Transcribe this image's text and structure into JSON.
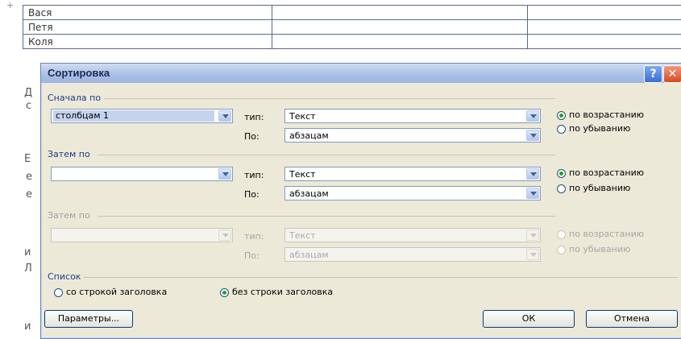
{
  "document": {
    "rows": [
      {
        "name": "Вася"
      },
      {
        "name": "Петя"
      },
      {
        "name": "Коля"
      }
    ],
    "handle_symbol": "+",
    "side_chars": [
      "Д",
      "с",
      "Е",
      "е",
      "е",
      "и",
      "Л",
      "и"
    ]
  },
  "dialog": {
    "title": "Сортировка",
    "help_symbol": "?",
    "close_symbol": "✕",
    "first": {
      "label": "Сначала по",
      "column_value": "столбцам 1",
      "type_label": "тип:",
      "type_value": "Текст",
      "by_label": "По:",
      "by_value": "абзацам",
      "asc_label": "по возрастанию",
      "desc_label": "по убыванию",
      "selected": "asc"
    },
    "second": {
      "label": "Затем по",
      "column_value": "",
      "type_label": "тип:",
      "type_value": "Текст",
      "by_label": "По:",
      "by_value": "абзацам",
      "asc_label": "по возрастанию",
      "desc_label": "по убыванию",
      "selected": "asc"
    },
    "third": {
      "label": "Затем по",
      "column_value": "",
      "type_label": "тип:",
      "type_value": "Текст",
      "by_label": "По:",
      "by_value": "абзацам",
      "asc_label": "по возрастанию",
      "desc_label": "по убыванию",
      "disabled": true
    },
    "list": {
      "label": "Список",
      "with_header_label": "со строкой заголовка",
      "without_header_label": "без строки заголовка",
      "selected": "without_header"
    },
    "buttons": {
      "options": "Параметры...",
      "ok": "ОК",
      "cancel": "Отмена"
    }
  },
  "colors": {
    "dialog_bg": "#ece9d8",
    "titlebar": "#a9bfe6",
    "group_label": "#1e3a8a",
    "selected_radio": "#21a121"
  }
}
